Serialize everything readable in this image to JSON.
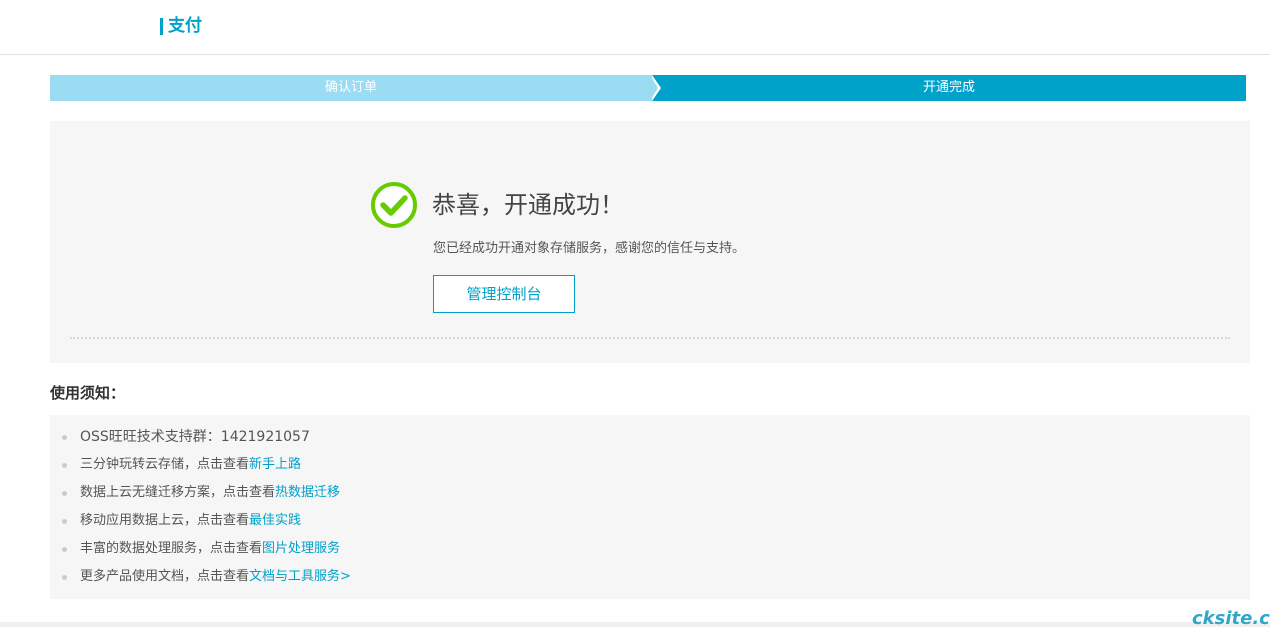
{
  "header": {
    "title": "支付",
    "accent_color": "#00a2ca"
  },
  "steps": [
    {
      "label": "确认订单",
      "state": "done",
      "color": "#9cdcf3"
    },
    {
      "label": "开通完成",
      "state": "active",
      "color": "#00a2ca"
    }
  ],
  "success": {
    "icon": "check-circle-icon",
    "icon_color": "#66cc00",
    "title": "恭喜，开通成功！",
    "description": "您已经成功开通对象存储服务，感谢您的信任与支持。",
    "button_label": "管理控制台"
  },
  "notice": {
    "title": "使用须知：",
    "items": [
      {
        "text": "OSS旺旺技术支持群：1421921057",
        "link": ""
      },
      {
        "text": "三分钟玩转云存储，点击查看",
        "link": "新手上路"
      },
      {
        "text": "数据上云无缝迁移方案，点击查看",
        "link": "热数据迁移"
      },
      {
        "text": "移动应用数据上云，点击查看",
        "link": "最佳实践"
      },
      {
        "text": "丰富的数据处理服务，点击查看",
        "link": "图片处理服务"
      },
      {
        "text": "更多产品使用文档，点击查看",
        "link": "文档与工具服务>"
      }
    ]
  },
  "watermark": "cksite.cn"
}
